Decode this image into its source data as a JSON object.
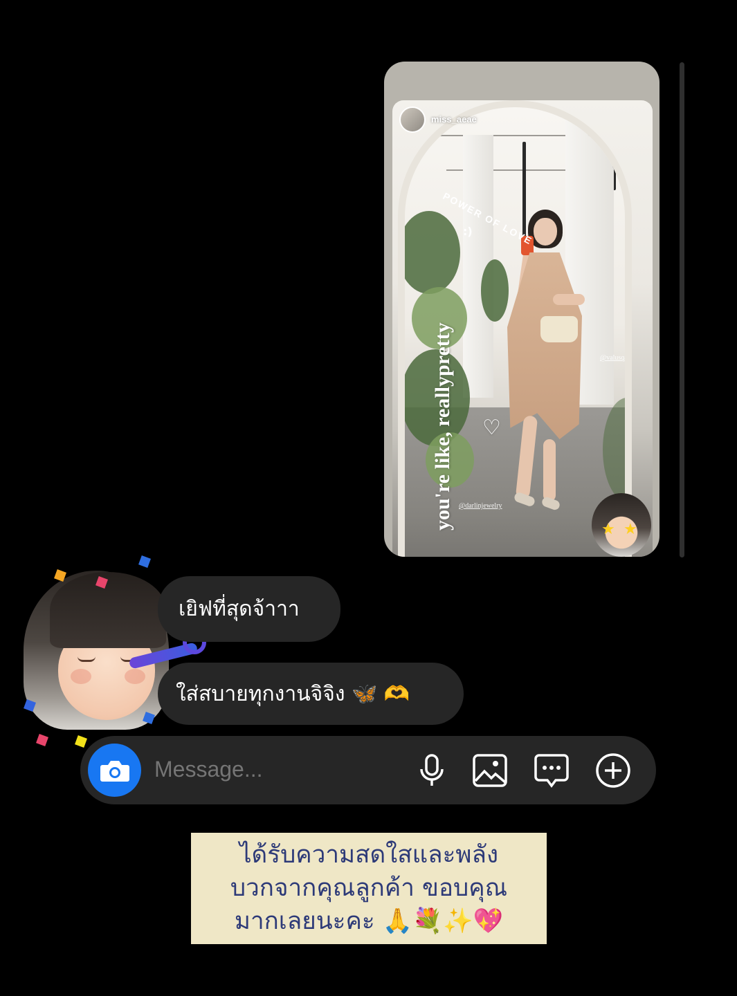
{
  "story": {
    "username": "miss_aeae",
    "vertical_caption": "you're like, reallypretty",
    "arc_caption": "POWER OF LOVE",
    "tag_1": "@valusqa",
    "tag_2": "@darlinjewelry",
    "heart_sticker": "♡",
    "reaction_eyes": "★"
  },
  "messages": [
    {
      "text": "เยิฟที่สุดจ้าาา"
    },
    {
      "text": "ใส่สบายทุกงานจิจิง 🦋 🫶"
    }
  ],
  "composer": {
    "placeholder": "Message...",
    "icons": [
      "camera-icon",
      "microphone-icon",
      "gallery-icon",
      "sticker-chat-icon",
      "plus-icon"
    ]
  },
  "caption": {
    "line_1": "ได้รับความสดใสและพลัง",
    "line_2": "บวกจากคุณลูกค้า ขอบคุณ",
    "line_3": "มากเลยนะคะ 🙏💐✨💖"
  },
  "colors": {
    "background": "#000000",
    "bubble": "#262626",
    "camera_button": "#1877f2",
    "caption_bg": "#efe7c6",
    "caption_text": "#2d3a78"
  }
}
